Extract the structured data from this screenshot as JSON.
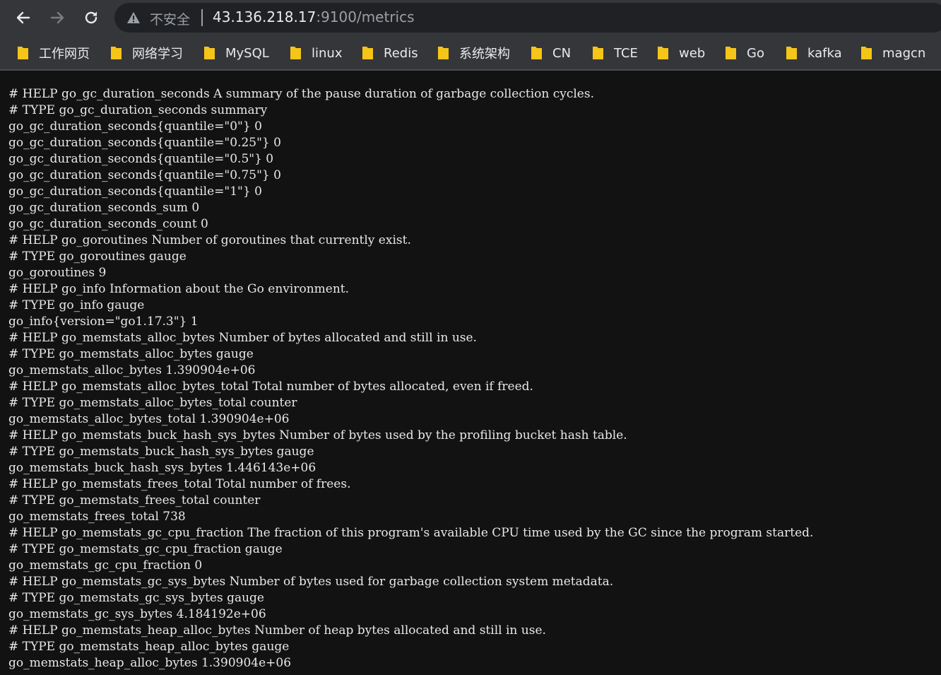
{
  "browser": {
    "security_label": "不安全",
    "url_host": "43.136.218.17",
    "url_rest": ":9100/metrics"
  },
  "bookmarks": [
    {
      "label": "工作网页",
      "icon": "folder-icon"
    },
    {
      "label": "网络学习",
      "icon": "folder-icon"
    },
    {
      "label": "MySQL",
      "icon": "folder-icon"
    },
    {
      "label": "linux",
      "icon": "folder-icon"
    },
    {
      "label": "Redis",
      "icon": "folder-icon"
    },
    {
      "label": "系统架构",
      "icon": "folder-icon"
    },
    {
      "label": "CN",
      "icon": "folder-icon"
    },
    {
      "label": "TCE",
      "icon": "folder-icon"
    },
    {
      "label": "web",
      "icon": "folder-icon"
    },
    {
      "label": "Go",
      "icon": "folder-icon"
    },
    {
      "label": "kafka",
      "icon": "folder-icon"
    },
    {
      "label": "magcn",
      "icon": "folder-icon"
    }
  ],
  "colors": {
    "toolbar_bg": "#35363a",
    "omnibox_bg": "#202124",
    "folder_yellow": "#f5c518",
    "page_bg": "#121212",
    "page_text": "#e8e8e8"
  },
  "metrics_lines": [
    "# HELP go_gc_duration_seconds A summary of the pause duration of garbage collection cycles.",
    "# TYPE go_gc_duration_seconds summary",
    "go_gc_duration_seconds{quantile=\"0\"} 0",
    "go_gc_duration_seconds{quantile=\"0.25\"} 0",
    "go_gc_duration_seconds{quantile=\"0.5\"} 0",
    "go_gc_duration_seconds{quantile=\"0.75\"} 0",
    "go_gc_duration_seconds{quantile=\"1\"} 0",
    "go_gc_duration_seconds_sum 0",
    "go_gc_duration_seconds_count 0",
    "# HELP go_goroutines Number of goroutines that currently exist.",
    "# TYPE go_goroutines gauge",
    "go_goroutines 9",
    "# HELP go_info Information about the Go environment.",
    "# TYPE go_info gauge",
    "go_info{version=\"go1.17.3\"} 1",
    "# HELP go_memstats_alloc_bytes Number of bytes allocated and still in use.",
    "# TYPE go_memstats_alloc_bytes gauge",
    "go_memstats_alloc_bytes 1.390904e+06",
    "# HELP go_memstats_alloc_bytes_total Total number of bytes allocated, even if freed.",
    "# TYPE go_memstats_alloc_bytes_total counter",
    "go_memstats_alloc_bytes_total 1.390904e+06",
    "# HELP go_memstats_buck_hash_sys_bytes Number of bytes used by the profiling bucket hash table.",
    "# TYPE go_memstats_buck_hash_sys_bytes gauge",
    "go_memstats_buck_hash_sys_bytes 1.446143e+06",
    "# HELP go_memstats_frees_total Total number of frees.",
    "# TYPE go_memstats_frees_total counter",
    "go_memstats_frees_total 738",
    "# HELP go_memstats_gc_cpu_fraction The fraction of this program's available CPU time used by the GC since the program started.",
    "# TYPE go_memstats_gc_cpu_fraction gauge",
    "go_memstats_gc_cpu_fraction 0",
    "# HELP go_memstats_gc_sys_bytes Number of bytes used for garbage collection system metadata.",
    "# TYPE go_memstats_gc_sys_bytes gauge",
    "go_memstats_gc_sys_bytes 4.184192e+06",
    "# HELP go_memstats_heap_alloc_bytes Number of heap bytes allocated and still in use.",
    "# TYPE go_memstats_heap_alloc_bytes gauge",
    "go_memstats_heap_alloc_bytes 1.390904e+06"
  ]
}
